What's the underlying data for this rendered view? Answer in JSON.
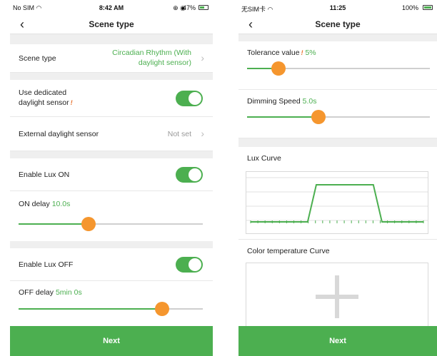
{
  "left": {
    "status": {
      "carrier": "No SIM",
      "time": "8:42 AM",
      "battery": "47%"
    },
    "nav": {
      "back": "‹",
      "title": "Scene type"
    },
    "scene_type": {
      "label": "Scene type",
      "value_line1": "Circadian Rhythm (With",
      "value_line2": "daylight sensor)"
    },
    "dedicated_sensor": {
      "label_line1": "Use dedicated",
      "label_line2": "daylight sensor",
      "warn": "!",
      "on": true
    },
    "external_sensor": {
      "label": "External daylight sensor",
      "value": "Not set"
    },
    "lux_on": {
      "label": "Enable Lux ON",
      "on": true
    },
    "on_delay": {
      "label": "ON delay",
      "value": "10.0s",
      "level": 0.38
    },
    "lux_off": {
      "label": "Enable Lux OFF",
      "on": true
    },
    "off_delay": {
      "label": "OFF delay",
      "value": "5min 0s",
      "level": 0.78
    },
    "next": "Next"
  },
  "right": {
    "status": {
      "carrier": "无SIM卡",
      "time": "11:25",
      "battery": "100%"
    },
    "nav": {
      "back": "‹",
      "title": "Scene type"
    },
    "tolerance": {
      "label": "Tolerance value",
      "warn": "!",
      "value": "5%",
      "level": 0.17
    },
    "dimming": {
      "label": "Dimming Speed",
      "value": "5.0s",
      "level": 0.39
    },
    "lux_curve": {
      "label": "Lux Curve",
      "points": [
        [
          0,
          0
        ],
        [
          0.33,
          0
        ],
        [
          0.38,
          1
        ],
        [
          0.71,
          1
        ],
        [
          0.76,
          0
        ],
        [
          1,
          0
        ]
      ]
    },
    "color_temp": {
      "label": "Color temperature Curve"
    },
    "next": "Next"
  },
  "colors": {
    "accent": "#4caf50",
    "thumb": "#f5962e",
    "warn": "#e8702a"
  }
}
